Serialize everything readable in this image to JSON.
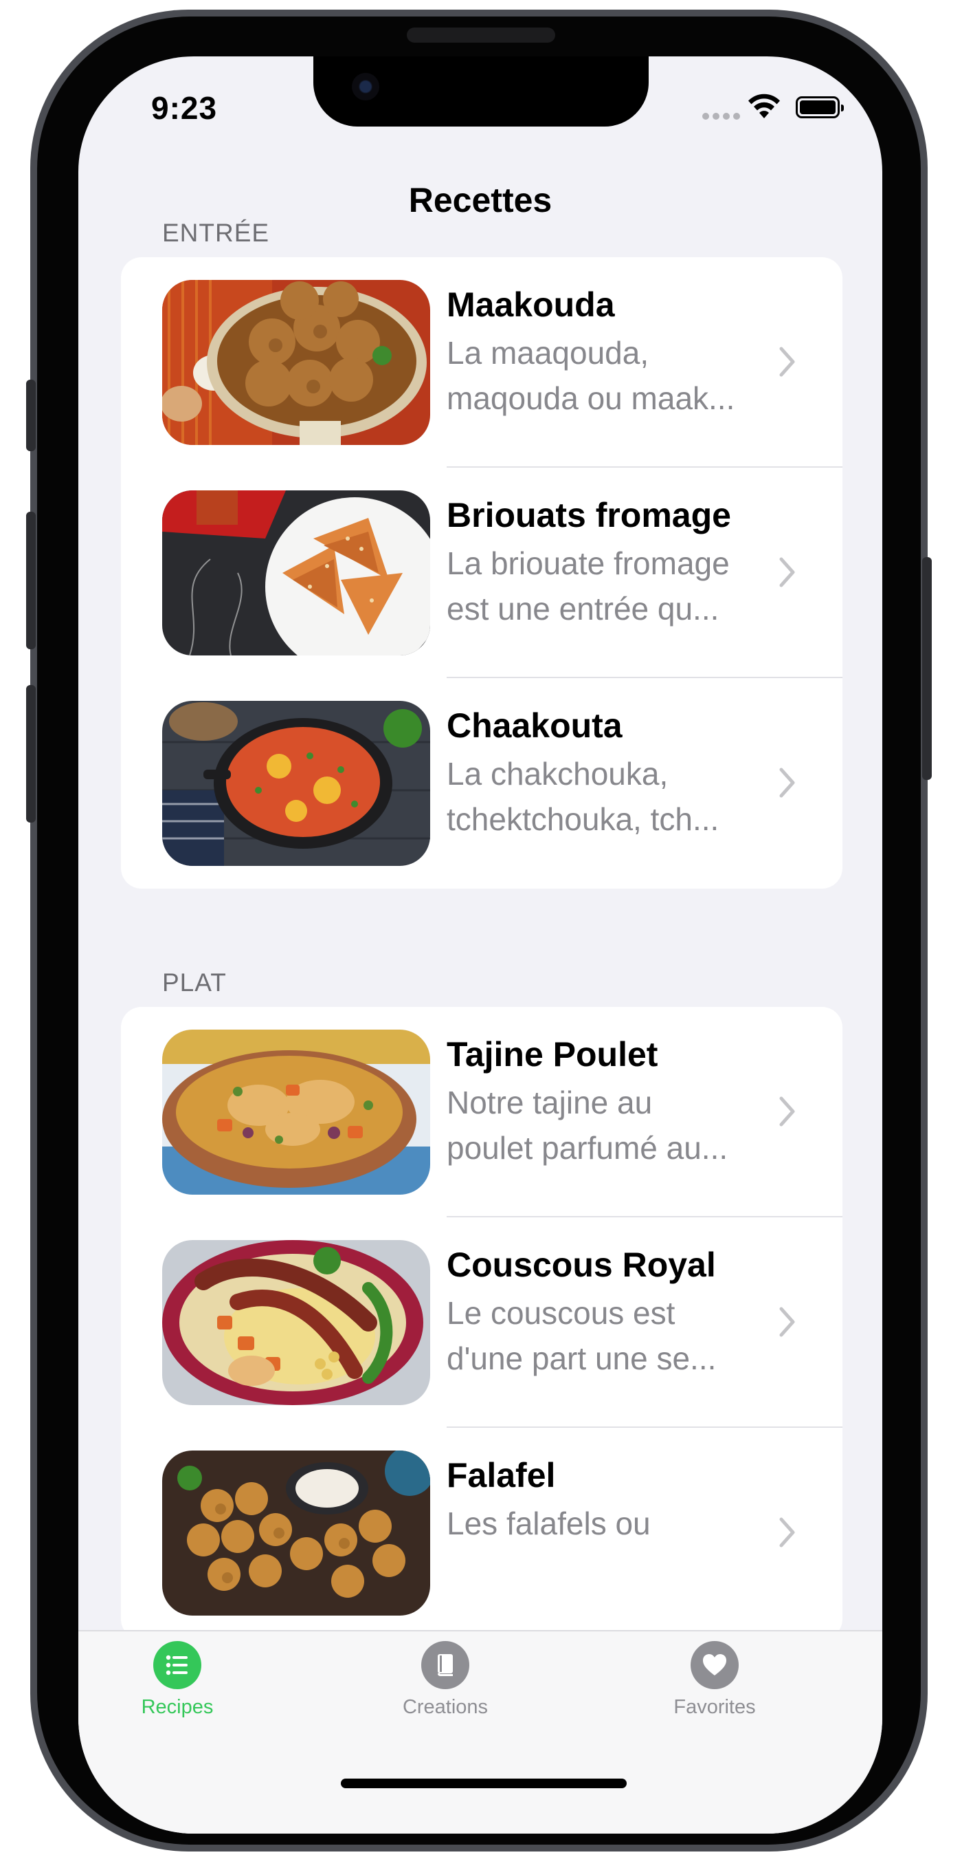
{
  "status_bar": {
    "time": "9:23"
  },
  "nav": {
    "title": "Recettes"
  },
  "sections": [
    {
      "header": "ENTRÉE",
      "rows": [
        {
          "title": "Maakouda",
          "desc_line1": "La maaqouda,",
          "desc_line2": "maqouda ou maak..."
        },
        {
          "title": "Briouats fromage",
          "desc_line1": "La briouate fromage",
          "desc_line2": "est une entrée qu..."
        },
        {
          "title": "Chaakouta",
          "desc_line1": "La chakchouka,",
          "desc_line2": "tchektchouka, tch..."
        }
      ]
    },
    {
      "header": "PLAT",
      "rows": [
        {
          "title": "Tajine Poulet",
          "desc_line1": "Notre tajine au",
          "desc_line2": "poulet parfumé au..."
        },
        {
          "title": "Couscous Royal",
          "desc_line1": "Le couscous est",
          "desc_line2": "d'une part une se..."
        },
        {
          "title": "Falafel",
          "desc_line1": "Les falafels ou",
          "desc_line2": ""
        }
      ]
    }
  ],
  "tabs": [
    {
      "label": "Recipes",
      "icon": "list-icon",
      "active": true
    },
    {
      "label": "Creations",
      "icon": "book-icon",
      "active": false
    },
    {
      "label": "Favorites",
      "icon": "heart-icon",
      "active": false
    }
  ],
  "colors": {
    "accent": "#34c759",
    "inactive": "#8e8e93",
    "background": "#f2f2f7",
    "secondary_text": "#87878c"
  }
}
